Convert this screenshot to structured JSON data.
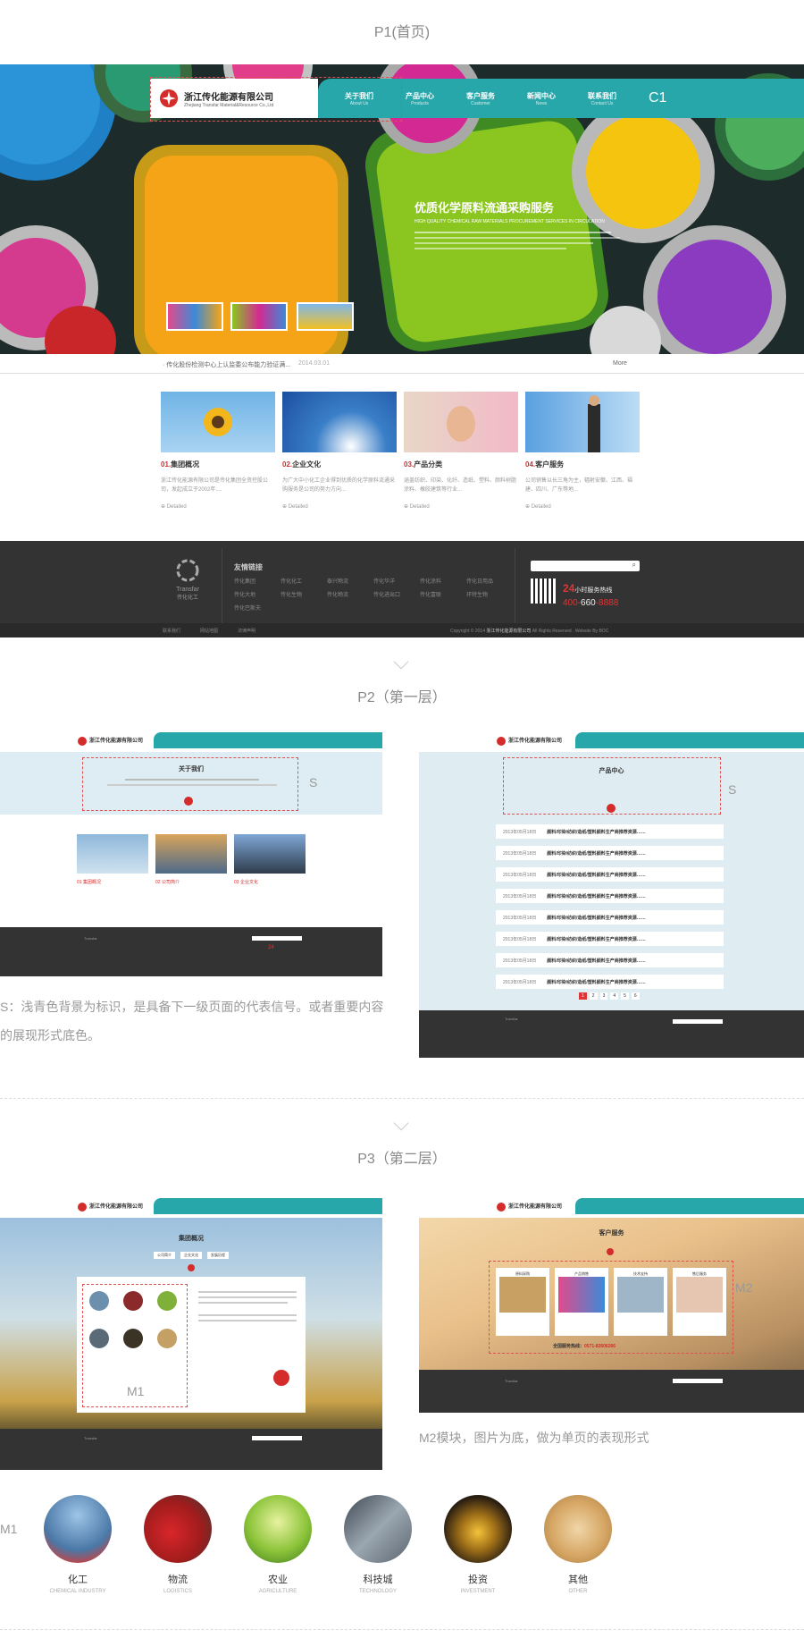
{
  "sections": {
    "p1": "P1(首页)",
    "p2": "P2（第一层）",
    "p3": "P3（第二层）"
  },
  "brand": {
    "name_cn": "浙江传化能源有限公司",
    "name_en": "Zhejiang Transfar Material&Resource Co.,Ltd",
    "footer_logo_en": "Transfar",
    "footer_logo_cn": "传化化工"
  },
  "nav": [
    {
      "cn": "关于我们",
      "en": "About Us"
    },
    {
      "cn": "产品中心",
      "en": "Products"
    },
    {
      "cn": "客户服务",
      "en": "Customer"
    },
    {
      "cn": "新闻中心",
      "en": "News"
    },
    {
      "cn": "联系我们",
      "en": "Contact Us"
    }
  ],
  "hero": {
    "tag": "C1",
    "title": "优质化学原料流通采购服务",
    "subtitle": "HIGH QUALITY CHEMICAL RAW MATERIALS PROCUREMENT SERVICES IN CIRCULATION"
  },
  "news": {
    "text": "传化股份检测中心上认监委公布能力验证满...",
    "date": "2014.03.01",
    "more": "More"
  },
  "cards": [
    {
      "num": "01.",
      "title": "集团概况",
      "desc": "浙江传化能源有限公司是传化集团全资控股公司，发起成立于2002年....",
      "more": "Detailed"
    },
    {
      "num": "02.",
      "title": "企业文化",
      "desc": "为广大中小化工企业得到优质的化学原料流通采购服务是公司的努力方向...",
      "more": "Detailed"
    },
    {
      "num": "03.",
      "title": "产品分类",
      "desc": "涵盖纺织、印染、化纤、造纸、塑料、颜料树脂涂料、橡胶建筑等行业...",
      "more": "Detailed"
    },
    {
      "num": "04.",
      "title": "客户服务",
      "desc": "公司销售以长三角为主，辐射安徽、江西、福建、四川、广东等地...",
      "more": "Detailed"
    }
  ],
  "footer": {
    "links_title": "友情链接",
    "links": [
      "传化集团",
      "传化化工",
      "泰兴物流",
      "传化华洋",
      "传化涂料",
      "传化日用品",
      "传化大地",
      "传化生物",
      "传化物流",
      "传化进出口",
      "传化富联",
      "环特生物",
      "传化巴斯夫"
    ],
    "hotline_num": "24",
    "hotline_label": "小时服务热线",
    "phone_a": "400-",
    "phone_b": "660",
    "phone_c": "-8888",
    "bottom_links": [
      "联系我们",
      "网站地图",
      "法律声明"
    ],
    "copyright_a": "Copyright © 2014 ",
    "copyright_b": "浙江传化能源有限公司",
    "copyright_c": " All Rights Reserved . Website By BOC"
  },
  "p2": {
    "about_title": "关于我们",
    "products_title": "产品中心",
    "tag": "S",
    "about_cards": [
      "01 集团概况",
      "02 公司简介",
      "03 企业文化"
    ],
    "row_date": "2013年05月18日",
    "row_text": "颜料/印染/纺织/造纸/塑料颜料生产商推荐资源……",
    "pages": [
      "1",
      "2",
      "3",
      "4",
      "5",
      "6"
    ],
    "note": "S：浅青色背景为标识，是具备下一级页面的代表信号。或者重要内容的展现形式底色。"
  },
  "p3": {
    "group_title": "集团概况",
    "service_title": "客户服务",
    "m1_tag": "M1",
    "m2_tag": "M2",
    "group_tabs": [
      "公司简介",
      "企业文化",
      "发展历程"
    ],
    "service_labels": [
      "原料采购",
      "产品销售",
      "技术支持",
      "售后服务"
    ],
    "service_hotline": "全国服务热线：",
    "service_phone": "0571-82606266",
    "note": "M2模块，图片为底，做为单页的表现形式"
  },
  "m1": {
    "tag": "M1",
    "items": [
      {
        "cn": "化工",
        "en": "CHEMICAL INDUSTRY",
        "icon": "chemical-plant-photo"
      },
      {
        "cn": "物流",
        "en": "LOGISTICS",
        "icon": "truck-photo"
      },
      {
        "cn": "农业",
        "en": "AGRICULTURE",
        "icon": "sprout-photo"
      },
      {
        "cn": "科技城",
        "en": "TECHNOLOGY",
        "icon": "building-photo"
      },
      {
        "cn": "投资",
        "en": "INVESTMENT",
        "icon": "golden-eggs-photo"
      },
      {
        "cn": "其他",
        "en": "OTHER",
        "icon": "wheat-photo"
      }
    ]
  }
}
